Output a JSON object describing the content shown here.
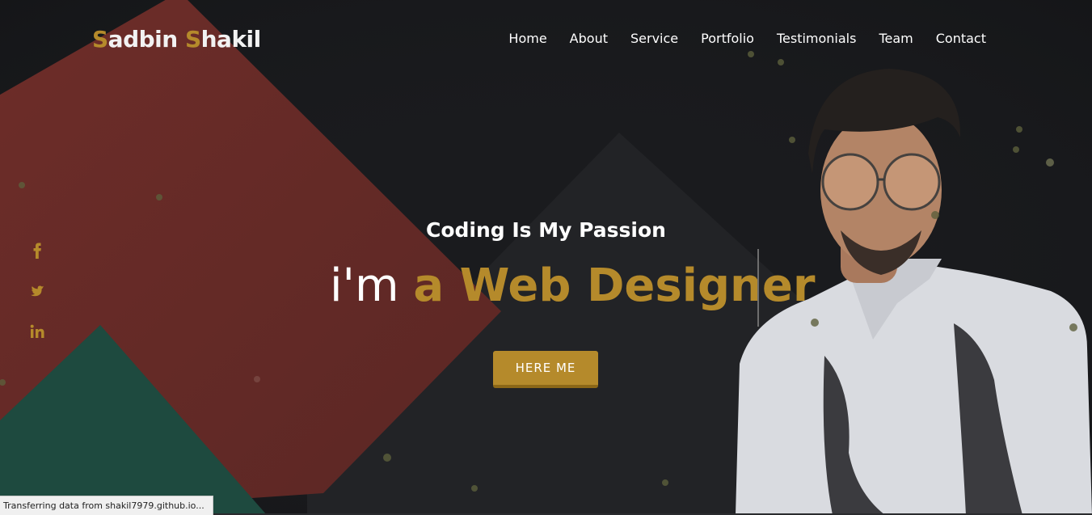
{
  "brand": {
    "first_initial": "S",
    "first_rest": "adbin",
    "last_initial": "S",
    "last_rest": "hakil",
    "accent_color": "#b58a2b"
  },
  "nav": {
    "items": [
      {
        "label": "Home"
      },
      {
        "label": "About"
      },
      {
        "label": "Service"
      },
      {
        "label": "Portfolio"
      },
      {
        "label": "Testimonials"
      },
      {
        "label": "Team"
      },
      {
        "label": "Contact"
      }
    ]
  },
  "social": [
    {
      "icon": "facebook-icon"
    },
    {
      "icon": "twitter-icon"
    },
    {
      "icon": "linkedin-icon"
    }
  ],
  "hero": {
    "tagline": "Coding Is My Passion",
    "headline_prefix": "i'm",
    "headline_role": "a Web Designer",
    "cta_label": "HERE ME",
    "photo": "portrait-photo"
  },
  "status": {
    "text": "Transferring data from shakil7979.github.io..."
  },
  "colors": {
    "background": "#1b1c1f",
    "red_shape": "#662b28",
    "green_shape": "#1d4a3f",
    "dark_shape": "#222326",
    "gold": "#b58a2b"
  }
}
